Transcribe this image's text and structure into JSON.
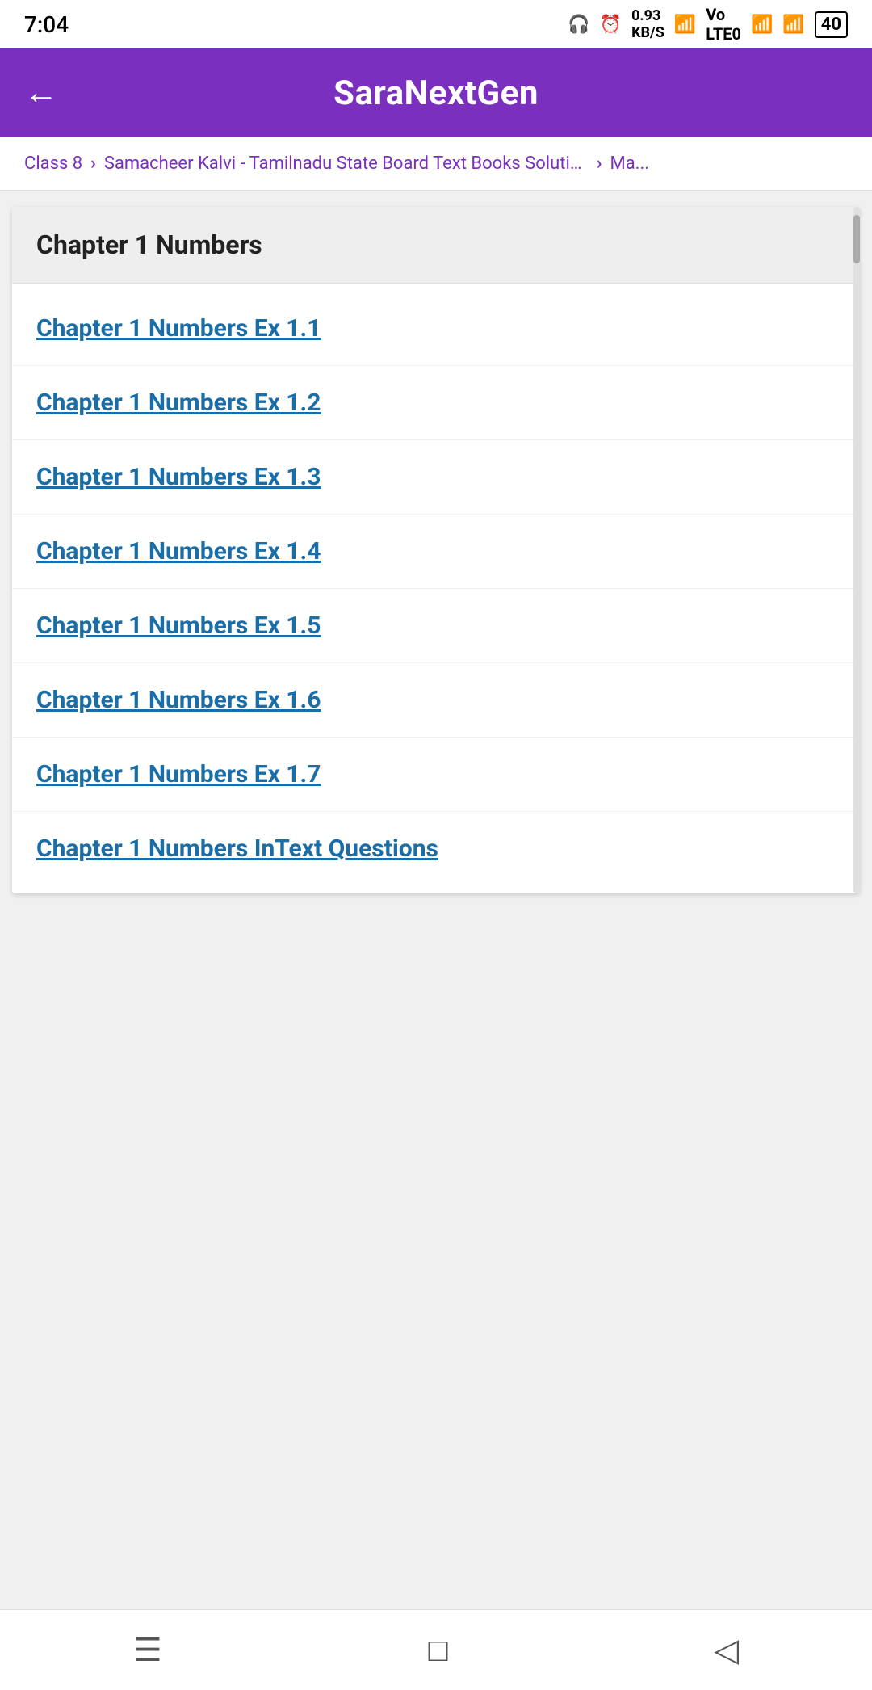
{
  "statusBar": {
    "time": "7:04",
    "batteryLevel": "40"
  },
  "appBar": {
    "title": "SaraNextGen",
    "backButtonSymbol": "←"
  },
  "breadcrumb": {
    "items": [
      {
        "label": "Class 8"
      },
      {
        "label": "Samacheer Kalvi - Tamilnadu State Board Text Books Solutions"
      },
      {
        "label": "Ma..."
      }
    ]
  },
  "chapterSection": {
    "headerTitle": "Chapter 1 Numbers",
    "items": [
      {
        "label": "Chapter 1 Numbers Ex 1.1"
      },
      {
        "label": "Chapter 1 Numbers Ex 1.2"
      },
      {
        "label": "Chapter 1 Numbers Ex 1.3"
      },
      {
        "label": "Chapter 1 Numbers Ex 1.4"
      },
      {
        "label": "Chapter 1 Numbers Ex 1.5"
      },
      {
        "label": "Chapter 1 Numbers Ex 1.6"
      },
      {
        "label": "Chapter 1 Numbers Ex 1.7"
      },
      {
        "label": "Chapter 1 Numbers InText Questions"
      }
    ]
  },
  "bottomNav": {
    "menuIcon": "☰",
    "homeIcon": "□",
    "backIcon": "◁"
  }
}
